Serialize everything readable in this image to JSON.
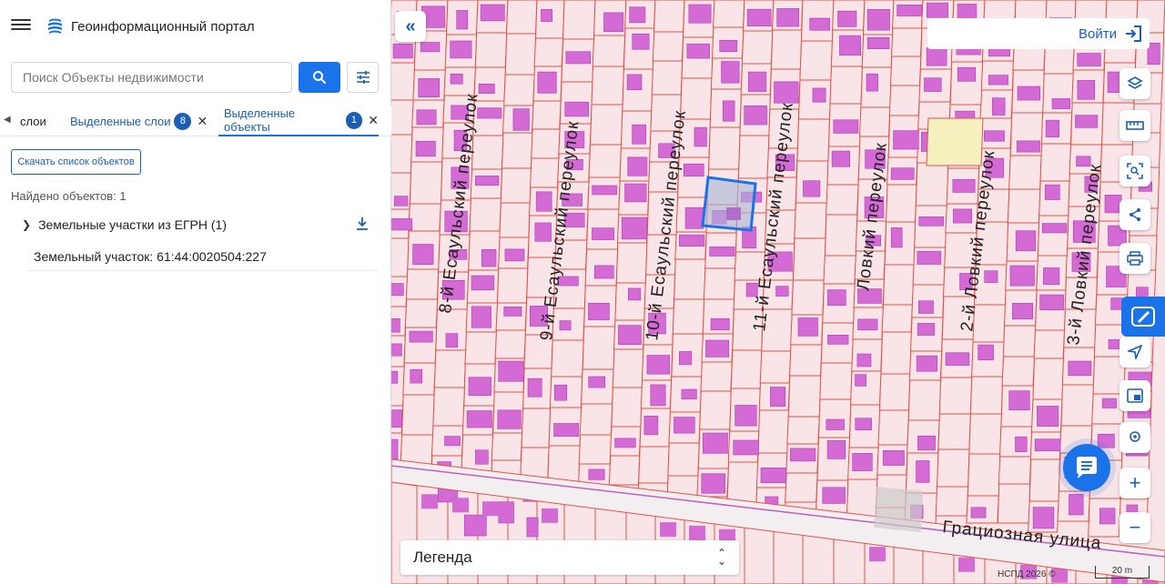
{
  "header": {
    "title": "Геоинформационный портал"
  },
  "search": {
    "placeholder": "Поиск Объекты недвижимости"
  },
  "tabs": {
    "back_label": "слои",
    "selected_layers": {
      "label": "Выделенные слои",
      "count": "8"
    },
    "selected_objects": {
      "label": "Выделенные объекты",
      "count": "1"
    }
  },
  "results": {
    "download_label": "Скачать список объектов",
    "found_text": "Найдено объектов: 1",
    "group_label": "Земельные участки из ЕГРН (1)",
    "item_label": "Земельный участок: 61:44:0020504:227"
  },
  "map": {
    "login_label": "Войти",
    "legend_label": "Легенда",
    "copyright": "НСПД 2026 ©",
    "scale_label": "20 m",
    "street_labels": [
      "8-й Есаульский переулок",
      "9-й Есаульский переулок",
      "10-й Есаульский переулок",
      "11-й Есаульский переулок",
      "Ловкий переулок",
      "2-й Ловкий переулок",
      "3-й Ловкий переулок",
      "Грациозная улица"
    ],
    "zoom_in": "+",
    "zoom_out": "−",
    "colors": {
      "parcel_fill": "#f9e4e7",
      "parcel_line": "#e0534a",
      "building": "#d46ad4",
      "selection": "#1a73e8",
      "accent": "#1a73e8",
      "highlight": "#f6f0bf"
    }
  }
}
